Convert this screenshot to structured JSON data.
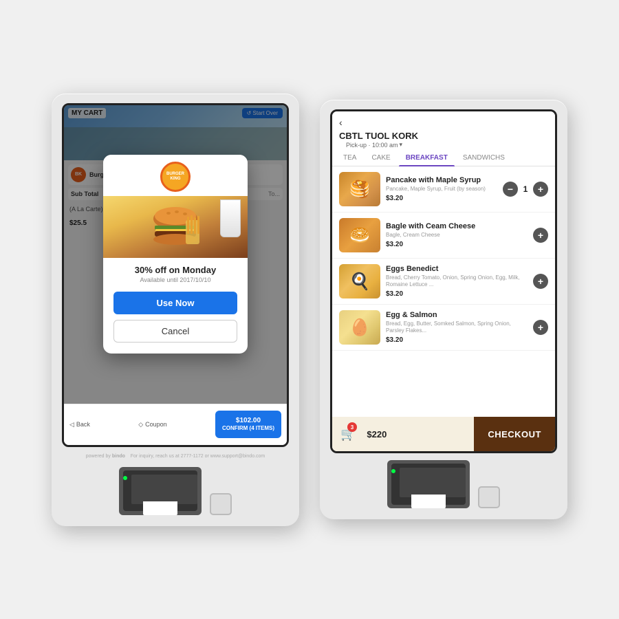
{
  "scene": {
    "bg_color": "#f0f0f0"
  },
  "kiosk_left": {
    "header": {
      "my_cart": "MY CART",
      "start_over": "↺ Start Over"
    },
    "cart_items": [
      {
        "brand": "BK",
        "name": "Burger King",
        "price": ""
      },
      {
        "brand": "",
        "name": "Sub Total",
        "price": "To..."
      }
    ],
    "sub_total": "$25.5",
    "modal": {
      "logo_text": "BURGER\nKING",
      "discount_title": "30% off on Monday",
      "available_until": "Available until 2017/10/10",
      "use_now_label": "Use Now",
      "cancel_label": "Cancel"
    },
    "footer": {
      "back_label": "Back",
      "coupon_label": "Coupon",
      "confirm_label": "$102.00",
      "confirm_sub": "CONFIRM (4 ITEMS)"
    }
  },
  "kiosk_right": {
    "store_name": "CBTL TUOL KORK",
    "pickup_label": "Pick-up · 10:00 am",
    "tabs": [
      {
        "label": "TEA",
        "active": false
      },
      {
        "label": "CAKE",
        "active": false
      },
      {
        "label": "BREAKFAST",
        "active": true
      },
      {
        "label": "SANDWICHS",
        "active": false
      }
    ],
    "menu_items": [
      {
        "name": "Pancake with Maple Syrup",
        "desc": "Pancake, Maple Syrup, Fruit (by season)",
        "price": "$3.20",
        "has_controls": true,
        "qty": "1",
        "type": "pancake"
      },
      {
        "name": "Bagle with Ceam Cheese",
        "desc": "Bagle, Cream Cheese",
        "price": "$3.20",
        "has_controls": false,
        "qty": "",
        "type": "bagel"
      },
      {
        "name": "Eggs Benedict",
        "desc": "Bread, Cherry Tomato, Onion, Spring Onion, Egg, Milk, Romaine Lettuce ...",
        "price": "$3.20",
        "has_controls": false,
        "qty": "",
        "type": "eggs"
      },
      {
        "name": "Egg & Salmon",
        "desc": "Bread, Egg, Butter, Somked Salmon, Spring Onion, Parsley Flakes...",
        "price": "$3.20",
        "has_controls": false,
        "qty": "",
        "type": "salmon"
      }
    ],
    "footer": {
      "cart_count": "3",
      "cart_total": "$220",
      "checkout_label": "CHECKOUT"
    }
  }
}
